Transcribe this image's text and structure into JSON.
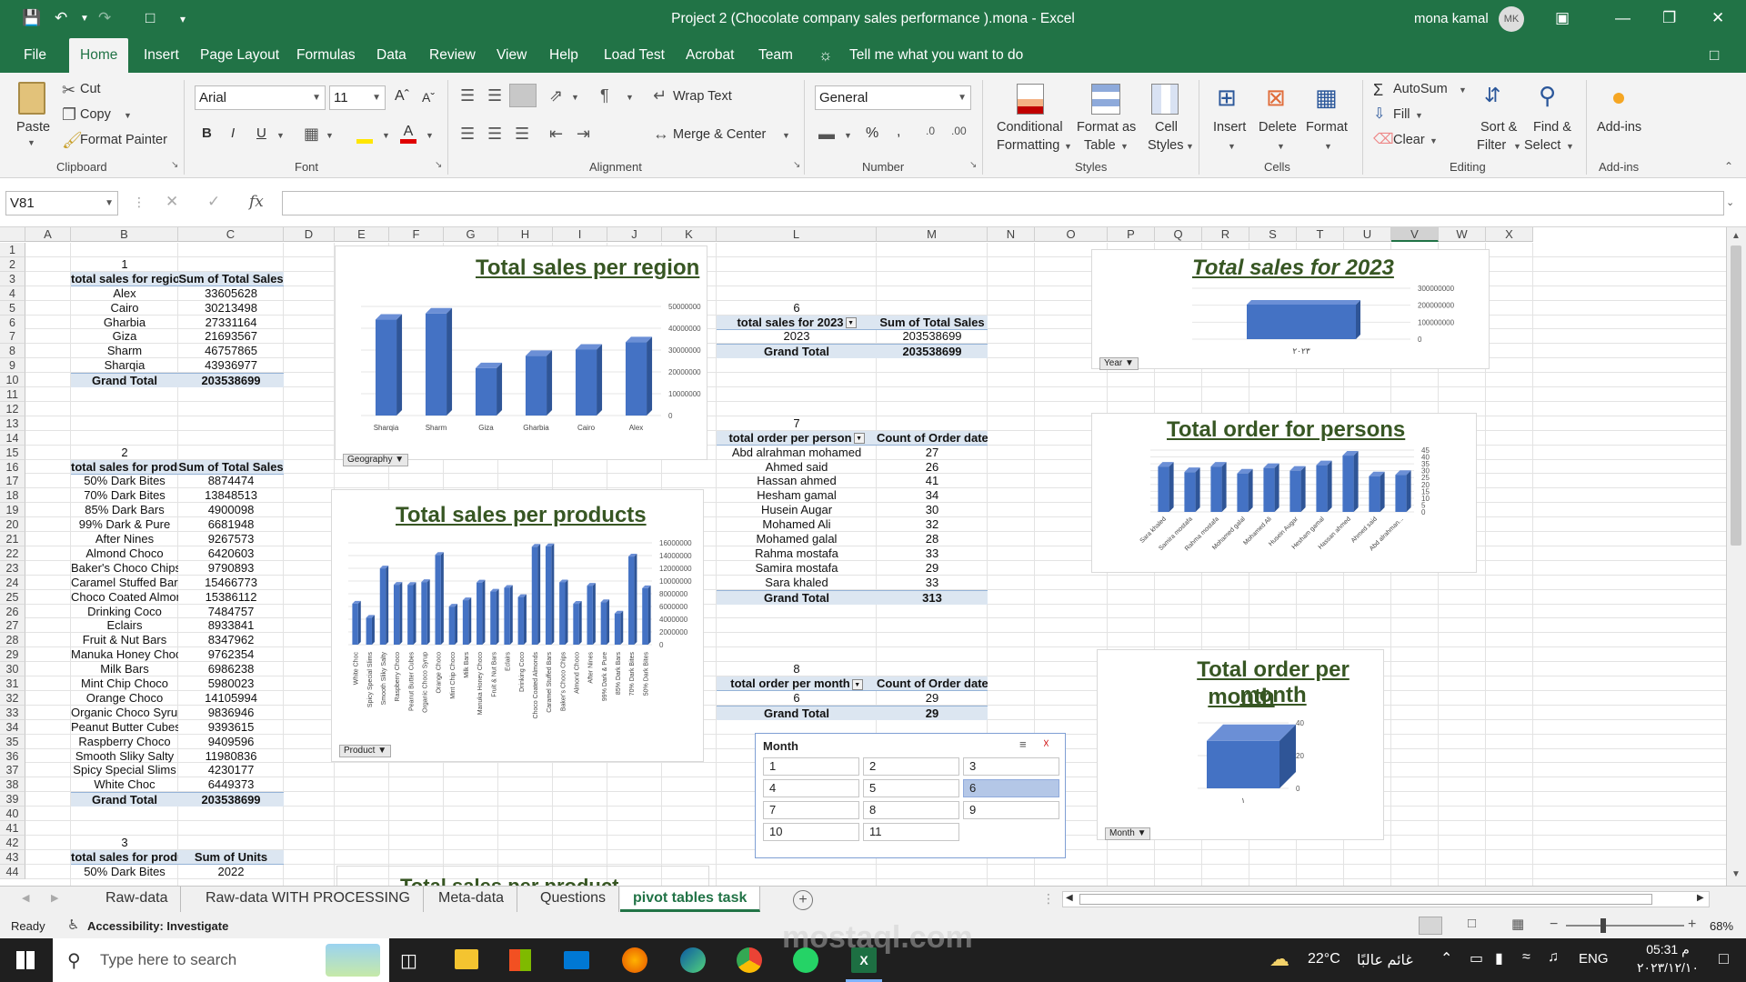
{
  "window": {
    "title": "Project 2 (Chocolate company sales performance ).mona  -  Excel",
    "user": "mona kamal",
    "avatar": "MK"
  },
  "menu": {
    "tabs": [
      "File",
      "Home",
      "Insert",
      "Page Layout",
      "Formulas",
      "Data",
      "Review",
      "View",
      "Help",
      "Load Test",
      "Acrobat",
      "Team"
    ],
    "active": "Home",
    "tell_me": "Tell me what you want to do"
  },
  "ribbon": {
    "clipboard": {
      "paste": "Paste",
      "cut": "Cut",
      "copy": "Copy",
      "format_painter": "Format Painter",
      "label": "Clipboard"
    },
    "font": {
      "name": "Arial",
      "size": "11",
      "label": "Font",
      "bold": "B",
      "italic": "I",
      "underline": "U"
    },
    "alignment": {
      "wrap": "Wrap Text",
      "merge": "Merge & Center",
      "label": "Alignment"
    },
    "number": {
      "format": "General",
      "label": "Number",
      "percent": "%",
      "comma": ","
    },
    "styles": {
      "conditional": "Conditional",
      "conditional2": "Formatting",
      "format_as": "Format as",
      "format_as2": "Table",
      "cell": "Cell",
      "cell2": "Styles",
      "label": "Styles"
    },
    "cells": {
      "insert": "Insert",
      "delete": "Delete",
      "format": "Format",
      "label": "Cells"
    },
    "editing": {
      "autosum": "AutoSum",
      "fill": "Fill",
      "clear": "Clear",
      "sort": "Sort &",
      "sort2": "Filter",
      "find": "Find &",
      "find2": "Select",
      "label": "Editing"
    },
    "addins": {
      "addins": "Add-ins",
      "label": "Add-ins"
    }
  },
  "formula_bar": {
    "name_box": "V81",
    "fx": "fx",
    "formula": ""
  },
  "columns": [
    "A",
    "B",
    "C",
    "D",
    "E",
    "F",
    "G",
    "H",
    "I",
    "J",
    "K",
    "L",
    "M",
    "N",
    "O",
    "P",
    "Q",
    "R",
    "S",
    "T",
    "U",
    "V",
    "W",
    "X"
  ],
  "rows": [
    "1",
    "2",
    "3",
    "4",
    "5",
    "6",
    "7",
    "8",
    "9",
    "10",
    "11",
    "12",
    "13",
    "14",
    "15",
    "16",
    "17",
    "18",
    "19",
    "20",
    "21",
    "22",
    "23",
    "24",
    "25",
    "26",
    "27",
    "28",
    "29",
    "30",
    "31",
    "32",
    "33",
    "34",
    "35",
    "36",
    "37",
    "38",
    "39",
    "40",
    "41",
    "42",
    "43",
    "44"
  ],
  "pivot1": {
    "index": "1",
    "h1": "total sales for region",
    "h2": "Sum of Total Sales",
    "rows": [
      [
        "Alex",
        "33605628"
      ],
      [
        "Cairo",
        "30213498"
      ],
      [
        "Gharbia",
        "27331164"
      ],
      [
        "Giza",
        "21693567"
      ],
      [
        "Sharm",
        "46757865"
      ],
      [
        "Sharqia",
        "43936977"
      ]
    ],
    "total": [
      "Grand Total",
      "203538699"
    ]
  },
  "pivot2": {
    "index": "2",
    "h1": "total sales for product",
    "h2": "Sum of Total Sales",
    "rows": [
      [
        "50% Dark Bites",
        "8874474"
      ],
      [
        "70% Dark Bites",
        "13848513"
      ],
      [
        "85% Dark Bars",
        "4900098"
      ],
      [
        "99% Dark & Pure",
        "6681948"
      ],
      [
        "After Nines",
        "9267573"
      ],
      [
        "Almond Choco",
        "6420603"
      ],
      [
        "Baker's Choco Chips",
        "9790893"
      ],
      [
        "Caramel Stuffed Bars",
        "15466773"
      ],
      [
        "Choco Coated Almonds",
        "15386112"
      ],
      [
        "Drinking Coco",
        "7484757"
      ],
      [
        "Eclairs",
        "8933841"
      ],
      [
        "Fruit & Nut Bars",
        "8347962"
      ],
      [
        "Manuka Honey Choco",
        "9762354"
      ],
      [
        "Milk Bars",
        "6986238"
      ],
      [
        "Mint Chip Choco",
        "5980023"
      ],
      [
        "Orange Choco",
        "14105994"
      ],
      [
        "Organic Choco Syrup",
        "9836946"
      ],
      [
        "Peanut Butter Cubes",
        "9393615"
      ],
      [
        "Raspberry Choco",
        "9409596"
      ],
      [
        "Smooth Sliky Salty",
        "11980836"
      ],
      [
        "Spicy Special Slims",
        "4230177"
      ],
      [
        "White Choc",
        "6449373"
      ]
    ],
    "total": [
      "Grand Total",
      "203538699"
    ]
  },
  "pivot3": {
    "index": "3",
    "h1": "total sales for product",
    "h2": "Sum of Units",
    "rows": [
      [
        "50% Dark Bites",
        "2022"
      ]
    ]
  },
  "pivot6": {
    "index": "6",
    "h1": "total sales for 2023",
    "h2": "Sum of Total Sales",
    "rows": [
      [
        "2023",
        "203538699"
      ]
    ],
    "total": [
      "Grand Total",
      "203538699"
    ]
  },
  "pivot7": {
    "index": "7",
    "h1": "total order per person",
    "h2": "Count of Order date",
    "rows": [
      [
        "Abd alrahman mohamed",
        "27"
      ],
      [
        "Ahmed said",
        "26"
      ],
      [
        "Hassan ahmed",
        "41"
      ],
      [
        "Hesham gamal",
        "34"
      ],
      [
        "Husein Augar",
        "30"
      ],
      [
        "Mohamed Ali",
        "32"
      ],
      [
        "Mohamed galal",
        "28"
      ],
      [
        "Rahma mostafa",
        "33"
      ],
      [
        "Samira mostafa",
        "29"
      ],
      [
        "Sara khaled",
        "33"
      ]
    ],
    "total": [
      "Grand Total",
      "313"
    ]
  },
  "pivot8": {
    "index": "8",
    "h1": "total order per month",
    "h2": "Count of Order date",
    "rows": [
      [
        "6",
        "29"
      ]
    ],
    "total": [
      "Grand Total",
      "29"
    ]
  },
  "slicer": {
    "title": "Month",
    "items": [
      "1",
      "2",
      "3",
      "4",
      "5",
      "6",
      "7",
      "8",
      "9",
      "10",
      "11"
    ],
    "selected": "6"
  },
  "chart_data": [
    {
      "type": "bar",
      "title": "Total sales per region",
      "categories": [
        "Sharqia",
        "Sharm",
        "Giza",
        "Gharbia",
        "Cairo",
        "Alex"
      ],
      "values": [
        43936977,
        46757865,
        21693567,
        27331164,
        30213498,
        33605628
      ],
      "ylim": [
        0,
        50000000
      ],
      "yticks": [
        "50000000",
        "40000000",
        "30000000",
        "20000000",
        "10000000",
        "0"
      ],
      "filter": "Geography"
    },
    {
      "type": "bar",
      "title": "Total sales per products",
      "categories": [
        "White Choc",
        "Spicy Special Slims",
        "Smooth Sliky Salty",
        "Raspberry Choco",
        "Peanut Butter Cubes",
        "Organic Choco Syrup",
        "Orange Choco",
        "Mint Chip Choco",
        "Milk Bars",
        "Manuka Honey Choco",
        "Fruit & Nut Bars",
        "Eclairs",
        "Drinking Coco",
        "Choco Coated Almonds",
        "Caramel Stuffed Bars",
        "Baker's Choco Chips",
        "Almond Choco",
        "After Nines",
        "99% Dark & Pure",
        "85% Dark Bars",
        "70% Dark Bites",
        "50% Dark Bites"
      ],
      "values": [
        6449373,
        4230177,
        11980836,
        9409596,
        9393615,
        9836946,
        14105994,
        5980023,
        6986238,
        9762354,
        8347962,
        8933841,
        7484757,
        15386112,
        15466773,
        9790893,
        6420603,
        9267573,
        6681948,
        4900098,
        13848513,
        8874474
      ],
      "ylim": [
        0,
        16000000
      ],
      "yticks": [
        "16000000",
        "14000000",
        "12000000",
        "10000000",
        "8000000",
        "6000000",
        "4000000",
        "2000000",
        "0"
      ],
      "filter": "Product"
    },
    {
      "type": "bar",
      "title": "Total sales for 2023",
      "categories": [
        "٢٠٢٣"
      ],
      "values": [
        203538699
      ],
      "ylim": [
        0,
        300000000
      ],
      "yticks": [
        "300000000",
        "200000000",
        "100000000",
        "0"
      ],
      "filter": "Year"
    },
    {
      "type": "bar",
      "title": "Total order for persons",
      "categories": [
        "Sara khaled",
        "Samira mostafa",
        "Rahma mostafa",
        "Mohamed galal",
        "Mohamed Ali",
        "Husein Augar",
        "Hesham gamal",
        "Hassan ahmed",
        "Ahmed said",
        "Abd alrahman..."
      ],
      "values": [
        33,
        29,
        33,
        28,
        32,
        30,
        34,
        41,
        26,
        27
      ],
      "ylim": [
        0,
        45
      ],
      "yticks": [
        "45",
        "40",
        "35",
        "30",
        "25",
        "20",
        "15",
        "10",
        "5",
        "0"
      ]
    },
    {
      "type": "bar",
      "title": "Total order per month",
      "title2": "month",
      "categories": [
        "١"
      ],
      "values": [
        29
      ],
      "ylim": [
        0,
        40
      ],
      "yticks": [
        "40",
        "20",
        "0"
      ],
      "filter": "Month"
    }
  ],
  "chart_partial_title": "Total sales per product",
  "sheet_tabs": [
    "Raw-data",
    "Raw-data WITH PROCESSING",
    "Meta-data",
    "Questions",
    "pivot tables task"
  ],
  "active_sheet": "pivot tables task",
  "status": {
    "ready": "Ready",
    "accessibility": "Accessibility: Investigate",
    "zoom": "68%"
  },
  "taskbar": {
    "search": "Type here to search",
    "temp": "22°C",
    "weather": "غائم عالبًا",
    "lang": "ENG",
    "time": "05:31 م",
    "date": "٢٠٢٣/١٢/١٠"
  },
  "watermark": {
    "text": "mostaql.com"
  },
  "colors": {
    "excel_green": "#217346",
    "bar_blue": "#4472c4",
    "title_green": "#375623",
    "pivot_header": "#dce6f1"
  }
}
